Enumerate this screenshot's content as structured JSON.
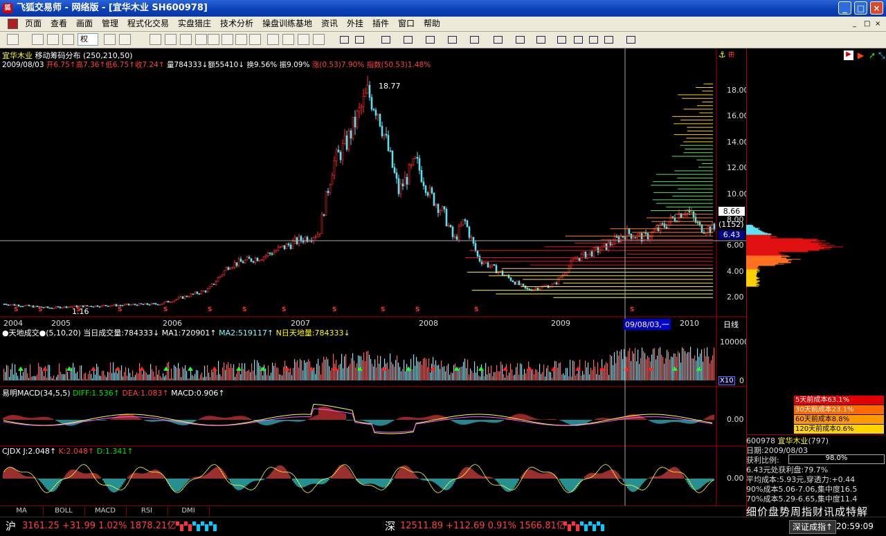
{
  "window": {
    "title": "飞狐交易师 - 网络版 - [宜华木业 SH600978]",
    "min": "_",
    "max": "□",
    "close": "×"
  },
  "menu": [
    "页面",
    "查看",
    "画面",
    "管理",
    "程式化交易",
    "实盘猎庄",
    "技术分析",
    "操盘训练基地",
    "资讯",
    "外挂",
    "插件",
    "窗口",
    "帮助"
  ],
  "toolbar": {
    "quan": "权"
  },
  "chart_header": {
    "stock_name": "宜华木业",
    "indicator": "移动筹码分布",
    "params": "(250,210,50)",
    "date": "2009/08/03",
    "open": "开6.75↑",
    "high": "高7.36↑",
    "low": "低6.75↑",
    "close": "收7.24↑",
    "volume": "量784333↓",
    "amount": "额55410↓",
    "turnover": "换9.56%",
    "amplitude": "振9.09%",
    "change": "涨(0.53)7.90%",
    "index": "指数(50.53)1.48%"
  },
  "price_axis": [
    "18.00",
    "16.00",
    "14.00",
    "12.00",
    "10.00",
    "8.00",
    "6.00",
    "4.00",
    "2.00"
  ],
  "price_marks": {
    "peak": "18.77",
    "low": "1.16",
    "current": "8.66",
    "count": "(1152)",
    "cursor": "6.43"
  },
  "time_axis": [
    "2004",
    "2005",
    "2006",
    "2007",
    "2008",
    "2009",
    "09/08/03,一",
    "2010"
  ],
  "period": "日线",
  "volume_panel": {
    "name": "天地成交",
    "params": "(5,10,20)",
    "today": "当日成交量:784333↓",
    "ma1": "MA1:720901↑",
    "ma2": "MA2:519117↑",
    "nday": "N日天地量:784333↓",
    "axis_top": "100000",
    "axis_bottom": "0",
    "multiplier": "X10"
  },
  "macd_panel": {
    "name": "易明MACD",
    "params": "(34,5,5)",
    "diff": "DIFF:1.536↑",
    "dea": "DEA:1.083↑",
    "macd": "MACD:0.906↑",
    "axis": "0.00"
  },
  "cjdx_panel": {
    "name": "CJDX",
    "j": "J:2.048↑",
    "k": "K:2.048↑",
    "d": "D:1.341↑",
    "axis": "0.00"
  },
  "tabs": [
    "MA",
    "BOLL",
    "MACD",
    "RSI",
    "DMI"
  ],
  "right_panel": {
    "costs": [
      {
        "label": "5天前成本63.1%",
        "color": "#e00000"
      },
      {
        "label": "30天前成本23.1%",
        "color": "#ff6a00"
      },
      {
        "label": "60天前成本8.8%",
        "color": "#ff9a00"
      },
      {
        "label": "120天前成本0.6%",
        "color": "#ffd400"
      }
    ],
    "code": "600978",
    "name": "宜华木业",
    "count": "(797)",
    "date": "日期:2009/08/03",
    "profit_label": "获利比例:",
    "profit_value": "98.0%",
    "profit_ratio": 0.98,
    "lines": [
      "6.43元处获利盘:79.7%",
      "平均成本:5.93元,穿透力:+0.44",
      "90%成本5.06-7.06,集中度16.5",
      "70%成本5.29-6.65,集中度11.4"
    ]
  },
  "status": {
    "sh_label": "沪",
    "sh_values": "3161.25 +31.99 1.02% 1878.21亿",
    "sz_label": "深",
    "sz_values": "12511.89 +112.69 0.91% 1566.81亿",
    "ticker": "细价盘势周指财讯成特解",
    "link": "深证成指↑",
    "time": "20:59:09"
  }
}
